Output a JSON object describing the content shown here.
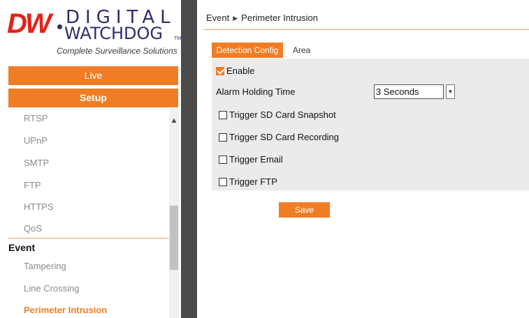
{
  "logo": {
    "dw": "DW",
    "digital": "DIGITAL",
    "watchdog": "WATCHDOG",
    "tm": "TM",
    "tagline": "Complete Surveillance Solutions"
  },
  "nav": {
    "live_label": "Live",
    "setup_label": "Setup"
  },
  "menu": {
    "network_items": [
      "RTSP",
      "UPnP",
      "SMTP",
      "FTP",
      "HTTPS",
      "QoS"
    ],
    "event_group": "Event",
    "event_items": [
      "Tampering",
      "Line Crossing",
      "Perimeter Intrusion"
    ],
    "active_item": "Perimeter Intrusion"
  },
  "breadcrumb": {
    "section": "Event",
    "page": "Perimeter Intrusion"
  },
  "tabs": {
    "detection_config": "Detection Config",
    "area": "Area"
  },
  "form": {
    "enable_label": "Enable",
    "enable_checked": true,
    "alarm_holding_label": "Alarm Holding Time",
    "alarm_holding_value": "3 Seconds",
    "triggers": [
      {
        "label": "Trigger SD Card Snapshot",
        "checked": false
      },
      {
        "label": "Trigger SD Card Recording",
        "checked": false
      },
      {
        "label": "Trigger Email",
        "checked": false
      },
      {
        "label": "Trigger FTP",
        "checked": false
      }
    ],
    "save_label": "Save"
  },
  "colors": {
    "accent": "#f07d26",
    "splitter": "#4a4a4a",
    "panel_bg": "#ebebeb"
  }
}
